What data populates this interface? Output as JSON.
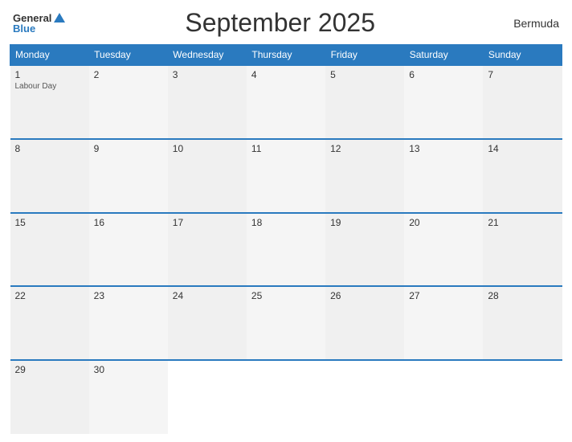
{
  "header": {
    "title": "September 2025",
    "region": "Bermuda",
    "logo": {
      "line1": "General",
      "line2": "Blue"
    }
  },
  "weekdays": [
    "Monday",
    "Tuesday",
    "Wednesday",
    "Thursday",
    "Friday",
    "Saturday",
    "Sunday"
  ],
  "weeks": [
    [
      {
        "day": "1",
        "holiday": "Labour Day"
      },
      {
        "day": "2",
        "holiday": ""
      },
      {
        "day": "3",
        "holiday": ""
      },
      {
        "day": "4",
        "holiday": ""
      },
      {
        "day": "5",
        "holiday": ""
      },
      {
        "day": "6",
        "holiday": ""
      },
      {
        "day": "7",
        "holiday": ""
      }
    ],
    [
      {
        "day": "8",
        "holiday": ""
      },
      {
        "day": "9",
        "holiday": ""
      },
      {
        "day": "10",
        "holiday": ""
      },
      {
        "day": "11",
        "holiday": ""
      },
      {
        "day": "12",
        "holiday": ""
      },
      {
        "day": "13",
        "holiday": ""
      },
      {
        "day": "14",
        "holiday": ""
      }
    ],
    [
      {
        "day": "15",
        "holiday": ""
      },
      {
        "day": "16",
        "holiday": ""
      },
      {
        "day": "17",
        "holiday": ""
      },
      {
        "day": "18",
        "holiday": ""
      },
      {
        "day": "19",
        "holiday": ""
      },
      {
        "day": "20",
        "holiday": ""
      },
      {
        "day": "21",
        "holiday": ""
      }
    ],
    [
      {
        "day": "22",
        "holiday": ""
      },
      {
        "day": "23",
        "holiday": ""
      },
      {
        "day": "24",
        "holiday": ""
      },
      {
        "day": "25",
        "holiday": ""
      },
      {
        "day": "26",
        "holiday": ""
      },
      {
        "day": "27",
        "holiday": ""
      },
      {
        "day": "28",
        "holiday": ""
      }
    ],
    [
      {
        "day": "29",
        "holiday": ""
      },
      {
        "day": "30",
        "holiday": ""
      },
      {
        "day": "",
        "holiday": ""
      },
      {
        "day": "",
        "holiday": ""
      },
      {
        "day": "",
        "holiday": ""
      },
      {
        "day": "",
        "holiday": ""
      },
      {
        "day": "",
        "holiday": ""
      }
    ]
  ]
}
